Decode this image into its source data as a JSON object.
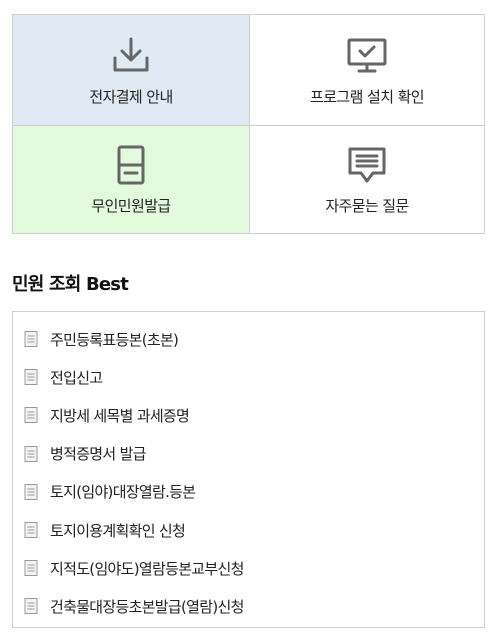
{
  "colors": {
    "tile_blue_bg": "#dfeaf4",
    "tile_green_bg": "#e2fbdc",
    "icon_gray": "#666666",
    "border": "#cfcfcf"
  },
  "quick_menu": [
    {
      "label": "전자결제 안내",
      "icon": "download-tray-icon"
    },
    {
      "label": "프로그램 설치 확인",
      "icon": "monitor-check-icon"
    },
    {
      "label": "무인민원발급",
      "icon": "kiosk-icon"
    },
    {
      "label": "자주묻는 질문",
      "icon": "speech-bubble-icon"
    }
  ],
  "best": {
    "title": "민원 조회 Best",
    "items": [
      "주민등록표등본(초본)",
      "전입신고",
      "지방세 세목별 과세증명",
      "병적증명서 발급",
      "토지(임야)대장열람.등본",
      "토지이용계획확인 신청",
      "지적도(임야도)열람등본교부신청",
      "건축물대장등초본발급(열람)신청"
    ],
    "item_icon": "document-icon"
  }
}
